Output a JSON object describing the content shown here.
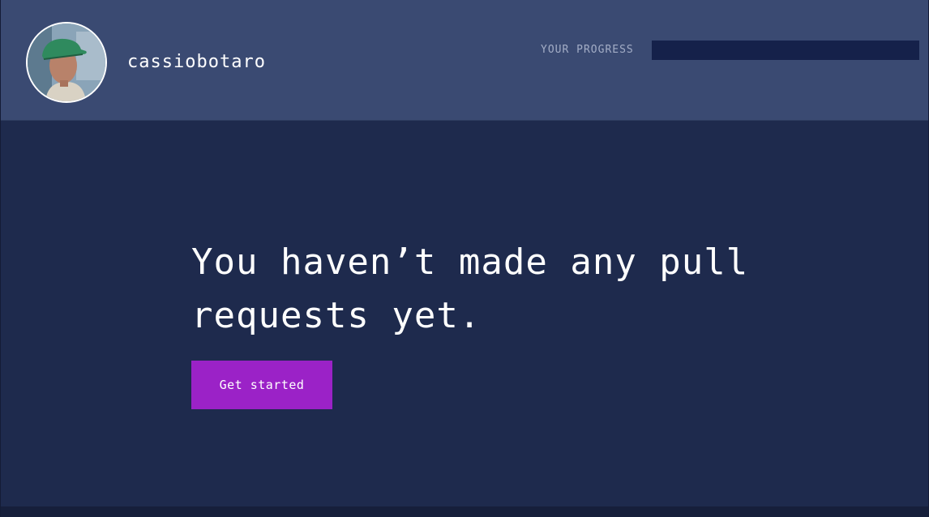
{
  "header": {
    "username": "cassiobotaro",
    "progress_label": "YOUR PROGRESS",
    "progress_fraction": 0
  },
  "main": {
    "empty_message": "You haven’t made any pull requests yet.",
    "cta_label": "Get started"
  },
  "colors": {
    "header_bg": "#3a4a72",
    "page_bg": "#1e2a4d",
    "progress_track": "#15214a",
    "accent": "#9b22c7"
  }
}
